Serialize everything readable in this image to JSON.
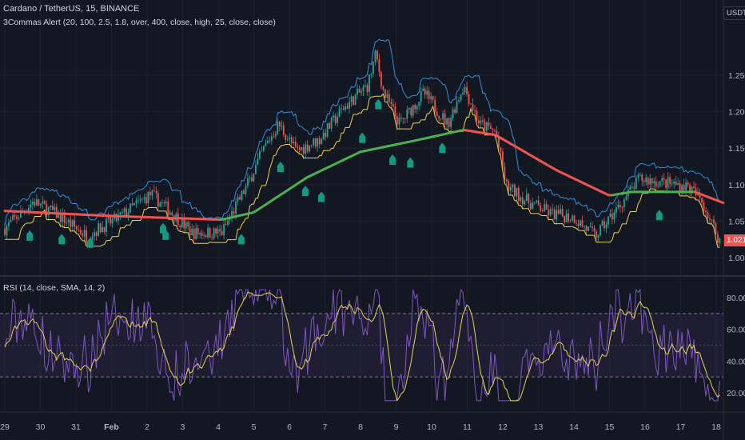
{
  "header": {
    "symbol": "Cardano / TetherUS, 15, BINANCE",
    "indicator": "3Commas Alert (20, 100, 2.5, 1.8, over, 400, close, high, 25, close, close)",
    "rsi": "RSI (14, close, SMA, 14, 2)",
    "currency": "USDT",
    "last_price": "1.021"
  },
  "colors": {
    "bg": "#131722",
    "up": "#26a69a",
    "down": "#ef5350",
    "upper": "#2f8fe0",
    "lower": "#e8d44d",
    "ma_up": "#4caf50",
    "ma_down": "#f05350",
    "alert": "#0f9b82",
    "rsi": "#7e57c2",
    "rsi_ma": "#e8d44d"
  },
  "chart_data": {
    "type": "line",
    "price_axis": {
      "ticks": [
        "1.250",
        "1.200",
        "1.150",
        "1.100",
        "1.050",
        "1.000"
      ],
      "values": [
        1.25,
        1.2,
        1.15,
        1.1,
        1.05,
        1.0
      ]
    },
    "rsi_axis": {
      "ticks": [
        "80.00",
        "60.00",
        "40.00",
        "20.00"
      ],
      "values": [
        80,
        60,
        40,
        20
      ],
      "bands": [
        70,
        50,
        30
      ]
    },
    "time_axis": {
      "labels": [
        "29",
        "30",
        "31",
        "Feb",
        "2",
        "3",
        "4",
        "5",
        "6",
        "7",
        "8",
        "9",
        "10",
        "11",
        "12",
        "13",
        "14",
        "15",
        "16",
        "17",
        "18"
      ],
      "days": [
        0,
        1,
        2,
        3,
        4,
        5,
        6,
        7,
        8,
        9,
        10,
        11,
        12,
        13,
        14,
        15,
        16,
        17,
        18,
        19,
        20
      ]
    },
    "close": [
      [
        0,
        1.04
      ],
      [
        0.8,
        1.077
      ],
      [
        1.44,
        1.06
      ],
      [
        2.3,
        1.03
      ],
      [
        3.2,
        1.055
      ],
      [
        4.1,
        1.087
      ],
      [
        4.6,
        1.066
      ],
      [
        5.26,
        1.034
      ],
      [
        6.1,
        1.034
      ],
      [
        6.8,
        1.098
      ],
      [
        7.3,
        1.151
      ],
      [
        7.7,
        1.183
      ],
      [
        8.2,
        1.146
      ],
      [
        8.85,
        1.162
      ],
      [
        9.5,
        1.204
      ],
      [
        10.2,
        1.236
      ],
      [
        10.43,
        1.279
      ],
      [
        10.65,
        1.226
      ],
      [
        11.1,
        1.183
      ],
      [
        11.78,
        1.226
      ],
      [
        12.45,
        1.183
      ],
      [
        12.9,
        1.236
      ],
      [
        13.35,
        1.183
      ],
      [
        13.8,
        1.172
      ],
      [
        14.1,
        1.098
      ],
      [
        14.7,
        1.077
      ],
      [
        15.37,
        1.06
      ],
      [
        16.0,
        1.055
      ],
      [
        16.6,
        1.029
      ],
      [
        17.2,
        1.066
      ],
      [
        17.84,
        1.108
      ],
      [
        18.5,
        1.103
      ],
      [
        19.2,
        1.098
      ],
      [
        19.6,
        1.077
      ],
      [
        20.1,
        1.023
      ]
    ],
    "ma": [
      [
        0,
        1.064
      ],
      [
        3,
        1.057
      ],
      [
        6.1,
        1.052
      ],
      [
        7,
        1.062
      ],
      [
        8.5,
        1.11
      ],
      [
        10,
        1.145
      ],
      [
        11.5,
        1.16
      ],
      [
        12.9,
        1.175
      ],
      [
        13.8,
        1.168
      ],
      [
        15.5,
        1.12
      ],
      [
        17,
        1.085
      ],
      [
        17.6,
        1.09
      ],
      [
        19.4,
        1.09
      ],
      [
        20.2,
        1.075
      ]
    ],
    "alerts": [
      [
        0.7,
        1.032
      ],
      [
        1.6,
        1.027
      ],
      [
        2.4,
        1.022
      ],
      [
        4.45,
        1.042
      ],
      [
        4.52,
        1.033
      ],
      [
        6.65,
        1.027
      ],
      [
        7.75,
        1.126
      ],
      [
        8.45,
        1.093
      ],
      [
        8.9,
        1.085
      ],
      [
        10.05,
        1.166
      ],
      [
        10.5,
        1.212
      ],
      [
        10.9,
        1.136
      ],
      [
        11.4,
        1.132
      ],
      [
        12.3,
        1.152
      ],
      [
        18.4,
        1.06
      ]
    ]
  }
}
